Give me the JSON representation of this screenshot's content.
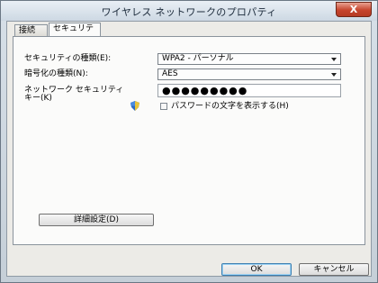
{
  "window": {
    "title": "ワイヤレス ネットワークのプロパティ",
    "close_glyph": "X"
  },
  "tabs": [
    {
      "label": "接続"
    },
    {
      "label": "セキュリティ"
    }
  ],
  "security": {
    "type_label": "セキュリティの種類(E):",
    "type_value": "WPA2 - パーソナル",
    "encryption_label": "暗号化の種類(N):",
    "encryption_value": "AES",
    "key_label_line1": "ネットワーク セキュリティ",
    "key_label_line2": "キー(K)",
    "key_masked": "●●●●●●●●●",
    "show_chars_label": "パスワードの文字を表示する(H)",
    "show_chars_checked": false
  },
  "advanced_button": "詳細設定(D)",
  "footer": {
    "ok": "OK",
    "cancel": "キャンセル"
  }
}
